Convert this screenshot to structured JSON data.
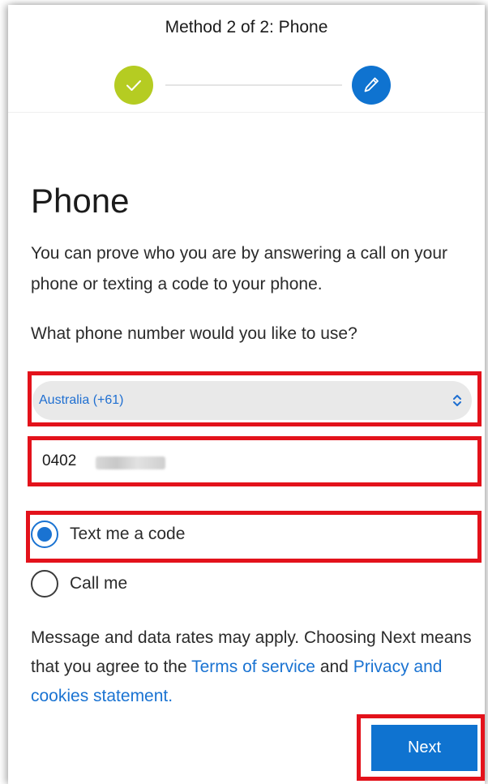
{
  "header": {
    "title": "Method 2 of 2: Phone",
    "steps": [
      {
        "state": "completed",
        "icon": "check-icon",
        "color": "#b5cc22"
      },
      {
        "state": "current",
        "icon": "pencil-icon",
        "color": "#0f73d0"
      }
    ]
  },
  "page": {
    "title": "Phone",
    "description": "You can prove who you are by answering a call on your phone or texting a code to your phone.",
    "question": "What phone number would you like to use?"
  },
  "country_select": {
    "selected": "Australia (+61)"
  },
  "phone_field": {
    "visible_value": "0402",
    "rest_obscured": true
  },
  "options": [
    {
      "label": "Text me a code",
      "checked": true
    },
    {
      "label": "Call me",
      "checked": false
    }
  ],
  "disclaimer": {
    "text_1": "Message and data rates may apply. Choosing Next means that you agree to the",
    "terms_link": "Terms of service",
    "text_2": "and",
    "privacy_link": "Privacy and cookies statement."
  },
  "next_button": {
    "label": "Next"
  },
  "colors": {
    "accent": "#0f73d0",
    "success": "#b5cc22",
    "highlight": "#e3121b"
  }
}
